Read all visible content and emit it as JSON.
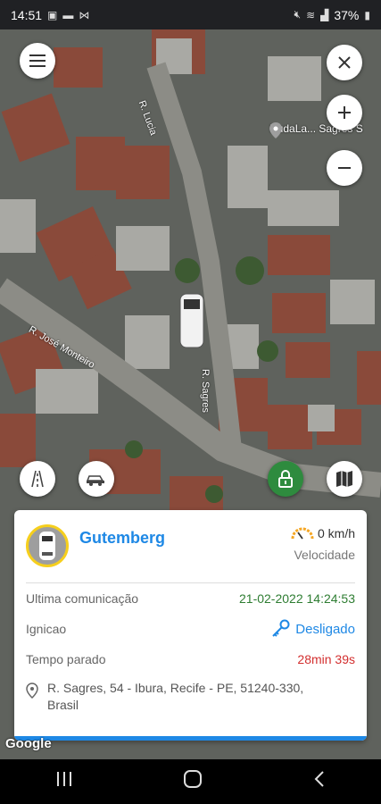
{
  "status_bar": {
    "time": "14:51",
    "left_icons": [
      "image-icon",
      "message-icon",
      "mail-icon"
    ],
    "battery": "37%"
  },
  "map": {
    "street_labels": [
      "R. Lucia",
      "R. José Monteiro",
      "R. Sagres"
    ],
    "poi_label": "DudaLa... Sagres S",
    "attribution": "Google"
  },
  "vehicle_card": {
    "vehicle_name": "Gutemberg",
    "speed": "0 km/h",
    "speed_label": "Velocidade",
    "rows": {
      "last_comm_label": "Ultima comunicação",
      "last_comm_value": "21-02-2022 14:24:53",
      "ignition_label": "Ignicao",
      "ignition_value": "Desligado",
      "stopped_label": "Tempo parado",
      "stopped_value": "28min 39s"
    },
    "address_line1": "R. Sagres, 54 - Ibura, Recife - PE, 51240-330,",
    "address_line2": "Brasil"
  },
  "colors": {
    "accent_blue": "#1e88e5",
    "green": "#2e7d32",
    "red": "#d32f2f",
    "avatar_ring": "#f6cf1d",
    "lock_green": "#2e8b3e"
  }
}
